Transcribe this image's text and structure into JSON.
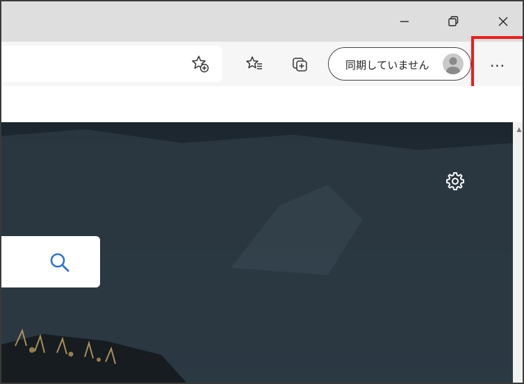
{
  "window": {
    "minimize_glyph": "—",
    "restore_label": "restore",
    "close_glyph": "✕"
  },
  "toolbar": {
    "more_label": "···",
    "sync_label": "同期していません",
    "icons": [
      "add-favorite-icon",
      "favorites-icon",
      "collections-icon",
      "profile-avatar-icon",
      "more-icon"
    ]
  },
  "content": {
    "icons": [
      "settings-gear-icon",
      "search-icon",
      "scroll-up-arrow-icon"
    ]
  },
  "colors": {
    "highlight": "#ee1c1c",
    "titlebar": "#dedede",
    "toolbar": "#f6f6f6",
    "background_dark": "#2a3743"
  }
}
